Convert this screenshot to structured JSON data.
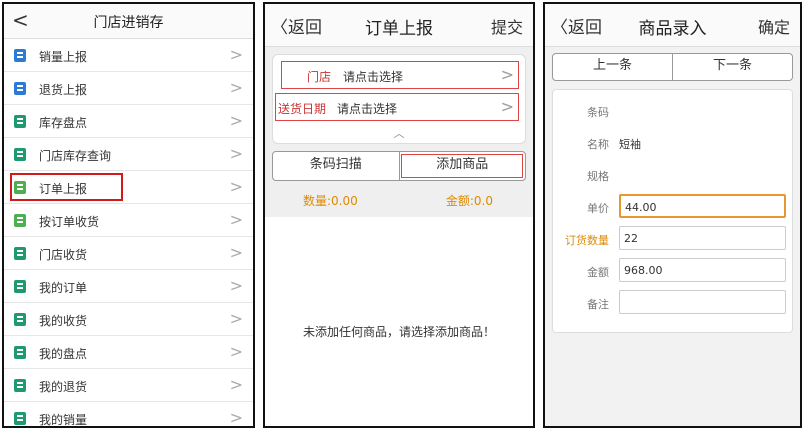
{
  "panel1": {
    "back": "<",
    "title": "门店进销存",
    "items": [
      {
        "label": "销量上报",
        "icon": "chart-icon",
        "color": "#2b7bd6"
      },
      {
        "label": "退货上报",
        "icon": "list-icon",
        "color": "#2b7bd6"
      },
      {
        "label": "库存盘点",
        "icon": "inventory-icon",
        "color": "#1f9a6e"
      },
      {
        "label": "门店库存查询",
        "icon": "search-stock-icon",
        "color": "#1f9a6e"
      },
      {
        "label": "订单上报",
        "icon": "upload-icon",
        "color": "#4caf50"
      },
      {
        "label": "按订单收货",
        "icon": "upload-icon",
        "color": "#4caf50"
      },
      {
        "label": "门店收货",
        "icon": "truck-icon",
        "color": "#1f9a6e"
      },
      {
        "label": "我的订单",
        "icon": "search-doc-icon",
        "color": "#1f9a6e"
      },
      {
        "label": "我的收货",
        "icon": "search-doc-icon",
        "color": "#1f9a6e"
      },
      {
        "label": "我的盘点",
        "icon": "search-doc-icon",
        "color": "#1f9a6e"
      },
      {
        "label": "我的退货",
        "icon": "search-doc-icon",
        "color": "#1f9a6e"
      },
      {
        "label": "我的销量",
        "icon": "search-doc-icon",
        "color": "#1f9a6e"
      }
    ],
    "chev": ">"
  },
  "panel2": {
    "back": "〈返回",
    "title": "订单上报",
    "submit": "提交",
    "store_label": "门店",
    "store_value": "请点击选择",
    "date_label": "送货日期",
    "date_value": "请点击选择",
    "collapse": "︿",
    "scan": "条码扫描",
    "add": "添加商品",
    "qty": "数量:0.00",
    "amount": "金额:0.0",
    "empty": "未添加任何商品，请选择添加商品！"
  },
  "panel3": {
    "back": "〈返回",
    "title": "商品录入",
    "confirm": "确定",
    "prev": "上一条",
    "next": "下一条",
    "fields": {
      "barcode": {
        "label": "条码",
        "value": ""
      },
      "name": {
        "label": "名称",
        "value": "短袖"
      },
      "spec": {
        "label": "规格",
        "value": ""
      },
      "price": {
        "label": "单价",
        "value": "44.00"
      },
      "order_qty": {
        "label": "订货数量",
        "value": "22"
      },
      "amount": {
        "label": "金额",
        "value": "968.00"
      },
      "remark": {
        "label": "备注",
        "value": ""
      }
    }
  },
  "accent": "#e08a00",
  "highlight": "#d21a1a"
}
